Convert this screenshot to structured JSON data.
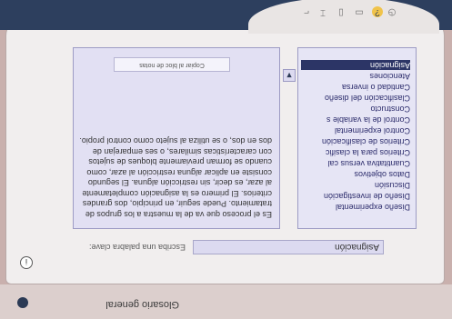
{
  "window": {
    "title": "Glosario general"
  },
  "header": {
    "info_icon": "info-icon"
  },
  "word_field": {
    "label": "Escriba una palabra clave:",
    "value": "Asignación"
  },
  "definition": {
    "text": "Es el proceso que va de la muestra a los grupos de tratamiento. Puede seguir, en principio, dos grandes criterios. El primero es la asignación completamente al azar, es decir, sin restricción alguna. El segundo consiste en aplicar alguna restricción al azar, como cuando se forman previamente bloques de sujetos con características similares, o ses emparejan de dos en dos, o se utiliza al sujeto como control propio.",
    "copy_button": "Copiar al bloc de notas"
  },
  "terms": [
    {
      "label": "Asignación",
      "selected": true
    },
    {
      "label": "Atenciones",
      "selected": false
    },
    {
      "label": "Cantidad o inversa",
      "selected": false
    },
    {
      "label": "Clasificación del diseño",
      "selected": false
    },
    {
      "label": "Constructo",
      "selected": false
    },
    {
      "label": "Control de la variable s",
      "selected": false
    },
    {
      "label": "Control experimental",
      "selected": false
    },
    {
      "label": "Criterios de clasificación",
      "selected": false
    },
    {
      "label": "Criterios para la clasific",
      "selected": false
    },
    {
      "label": "Cuantitativa versus cal",
      "selected": false
    },
    {
      "label": "Datos objetivos",
      "selected": false
    },
    {
      "label": "Discusión",
      "selected": false
    },
    {
      "label": "Diseño de investigación",
      "selected": false
    },
    {
      "label": "Diseño experimental",
      "selected": false
    }
  ],
  "toolbar": {
    "icons": [
      "help-icon",
      "clock-icon",
      "print-icon",
      "notes-icon",
      "tools-icon",
      "graph-icon"
    ]
  }
}
